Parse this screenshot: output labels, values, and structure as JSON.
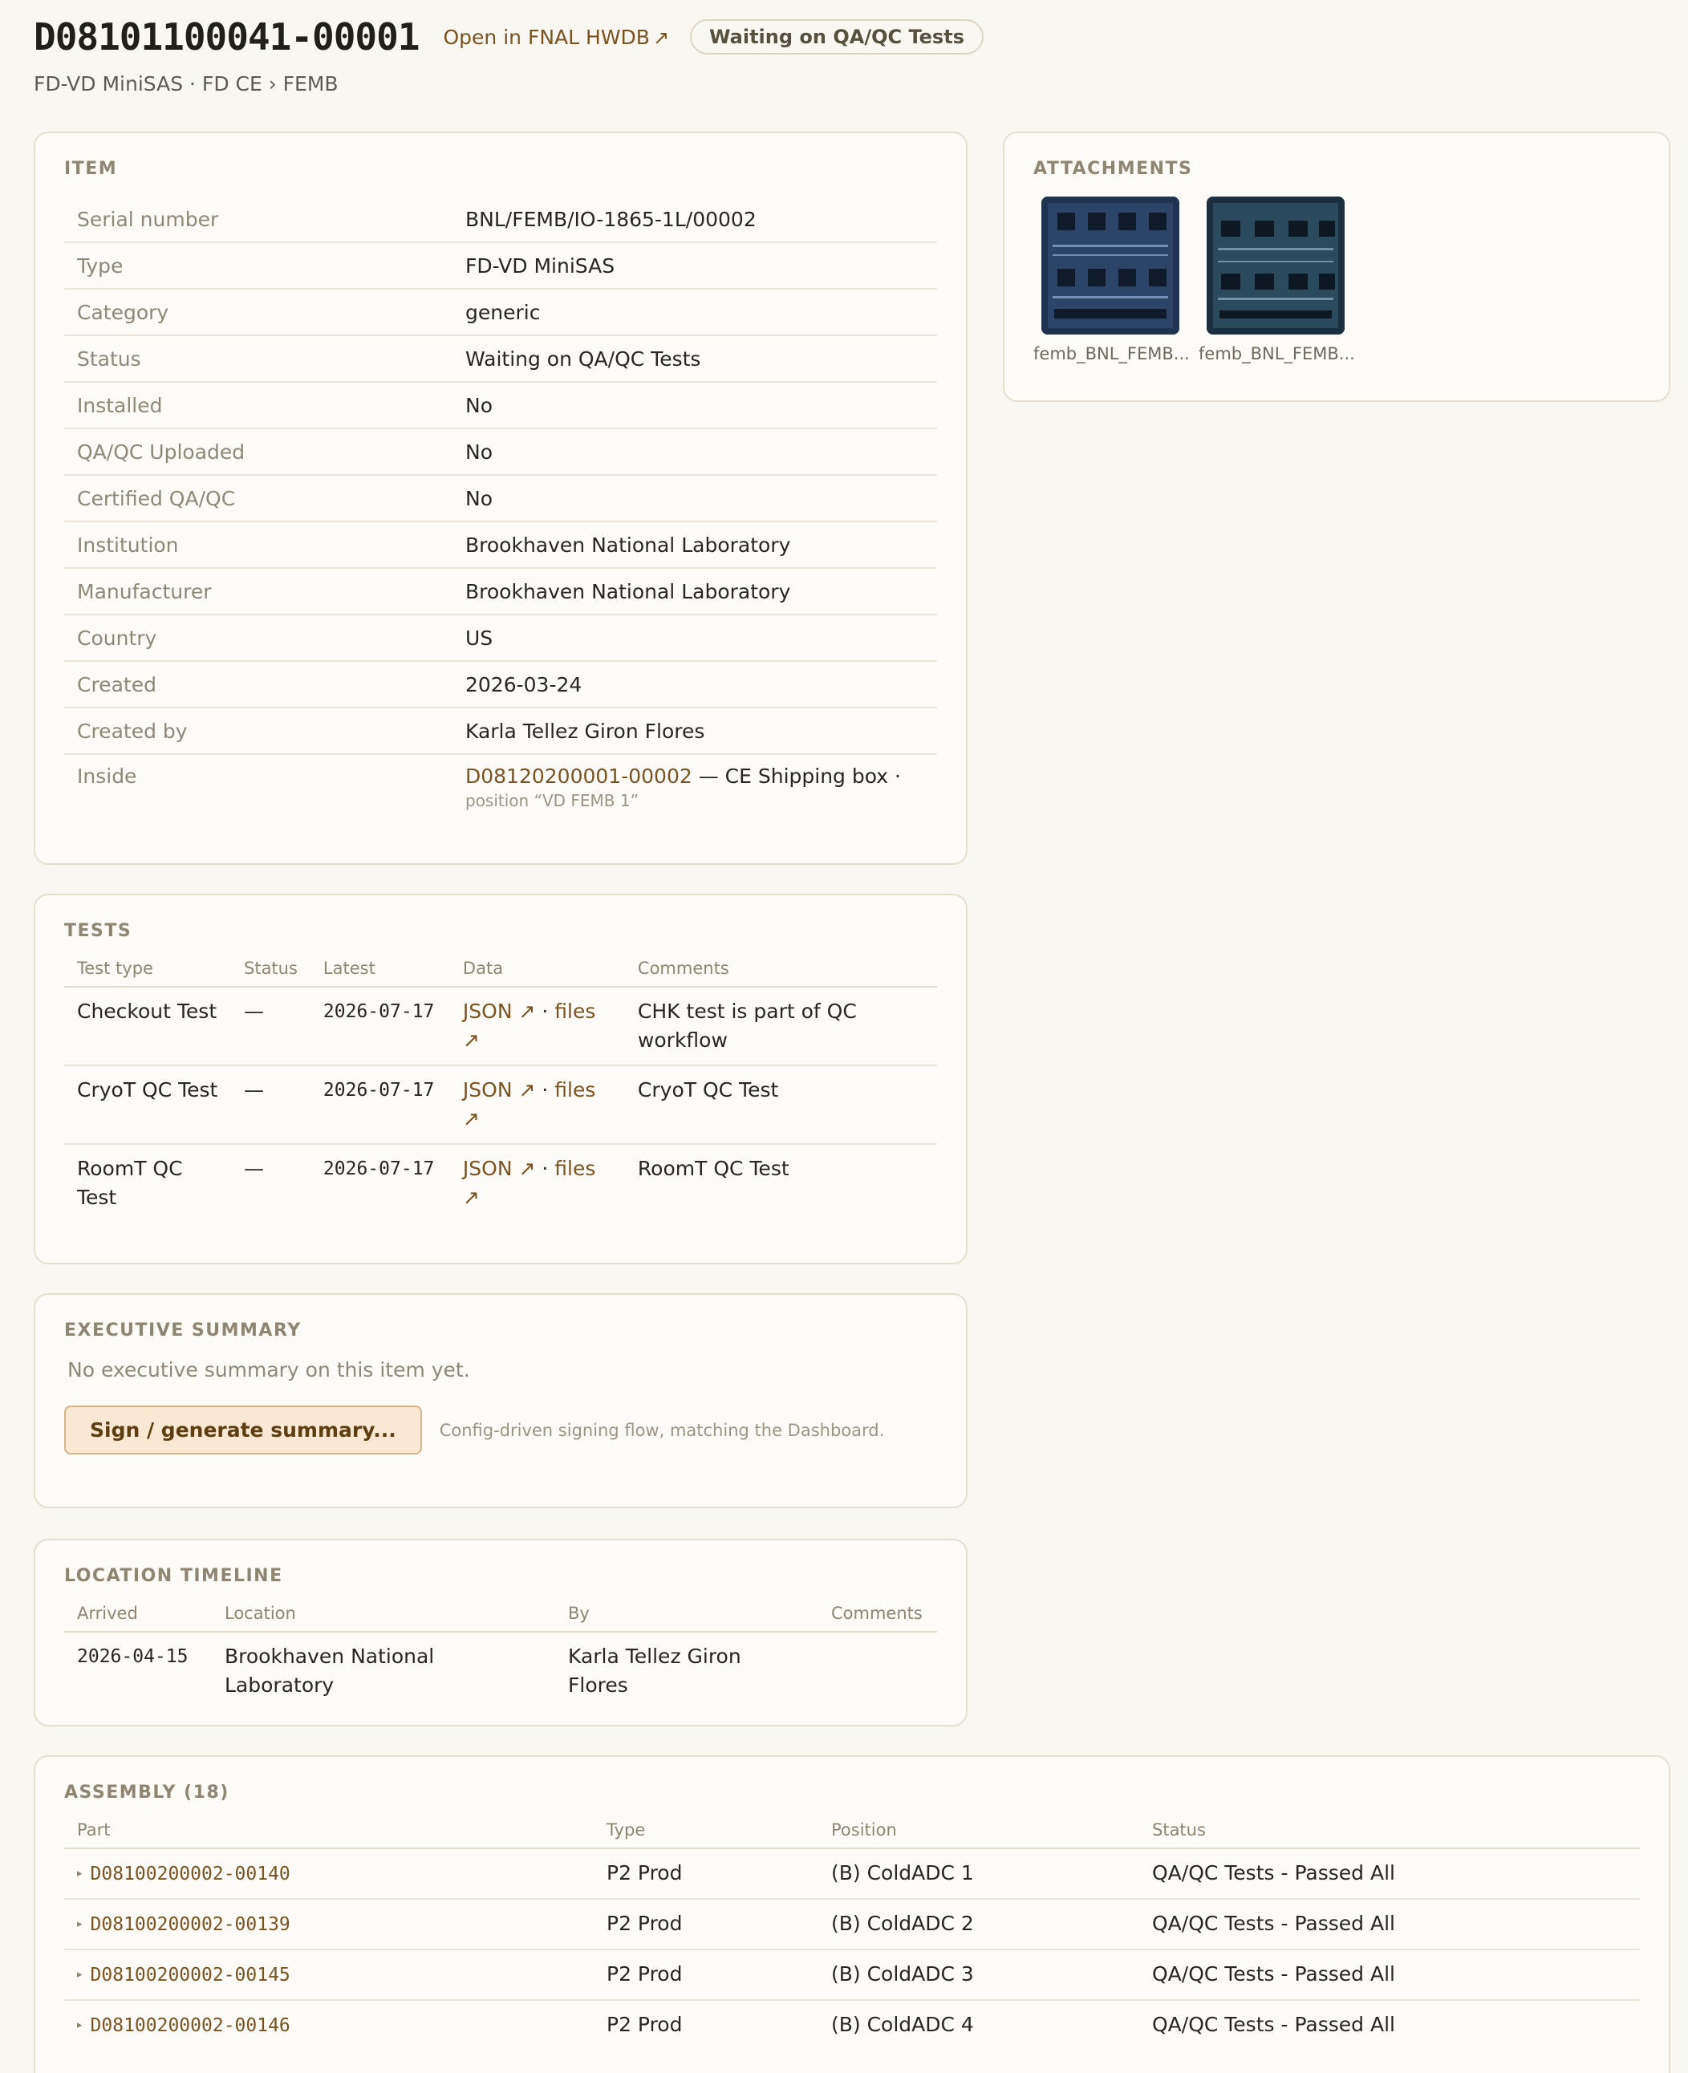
{
  "header": {
    "title": "D08101100041-00001",
    "hwdb_link": "Open in FNAL HWDB",
    "status": "Waiting on QA/QC Tests",
    "subtitle": "FD-VD MiniSAS · FD CE › FEMB"
  },
  "item": {
    "title": "ITEM",
    "rows": [
      {
        "key": "Serial number",
        "value": "BNL/FEMB/IO-1865-1L/00002"
      },
      {
        "key": "Type",
        "value": "FD-VD MiniSAS"
      },
      {
        "key": "Category",
        "value": "generic"
      },
      {
        "key": "Status",
        "value": "Waiting on QA/QC Tests"
      },
      {
        "key": "Installed",
        "value": "No"
      },
      {
        "key": "QA/QC Uploaded",
        "value": "No"
      },
      {
        "key": "Certified QA/QC",
        "value": "No"
      },
      {
        "key": "Institution",
        "value": "Brookhaven National Laboratory"
      },
      {
        "key": "Manufacturer",
        "value": "Brookhaven National Laboratory"
      },
      {
        "key": "Country",
        "value": "US"
      },
      {
        "key": "Created",
        "value": "2026-03-24"
      },
      {
        "key": "Created by",
        "value": "Karla Tellez Giron Flores"
      }
    ],
    "inside": {
      "key": "Inside",
      "link": "D08120200001-00002",
      "text": " — CE Shipping box ·",
      "position": "position “VD FEMB 1”"
    }
  },
  "attachments": {
    "title": "ATTACHMENTS",
    "files": [
      {
        "caption": "femb_BNL_FEMB..."
      },
      {
        "caption": "femb_BNL_FEMB..."
      }
    ]
  },
  "tests": {
    "title": "TESTS",
    "columns": [
      "Test type",
      "Status",
      "Latest",
      "Data",
      "Comments"
    ],
    "data_sep": " · ",
    "rows": [
      {
        "type": "Checkout Test",
        "status": "—",
        "latest": "2026-07-17",
        "json": "JSON",
        "files": "files",
        "comment": "CHK test is part of QC workflow"
      },
      {
        "type": "CryoT QC Test",
        "status": "—",
        "latest": "2026-07-17",
        "json": "JSON",
        "files": "files",
        "comment": "CryoT QC Test"
      },
      {
        "type": "RoomT QC Test",
        "status": "—",
        "latest": "2026-07-17",
        "json": "JSON",
        "files": "files",
        "comment": "RoomT QC Test"
      }
    ]
  },
  "exec": {
    "title": "EXECUTIVE SUMMARY",
    "empty": "No executive summary on this item yet.",
    "button": "Sign / generate summary...",
    "note": "Config-driven signing flow, matching the Dashboard."
  },
  "location": {
    "title": "LOCATION TIMELINE",
    "columns": [
      "Arrived",
      "Location",
      "By",
      "Comments"
    ],
    "rows": [
      {
        "arrived": "2026-04-15",
        "location": "Brookhaven National Laboratory",
        "by": "Karla Tellez Giron Flores",
        "comment": ""
      }
    ]
  },
  "assembly": {
    "title": "ASSEMBLY (18)",
    "columns": [
      "Part",
      "Type",
      "Position",
      "Status"
    ],
    "rows": [
      {
        "part": "D08100200002-00140",
        "type": "P2 Prod",
        "position": "(B) ColdADC 1",
        "status": "QA/QC Tests - Passed All"
      },
      {
        "part": "D08100200002-00139",
        "type": "P2 Prod",
        "position": "(B) ColdADC 2",
        "status": "QA/QC Tests - Passed All"
      },
      {
        "part": "D08100200002-00145",
        "type": "P2 Prod",
        "position": "(B) ColdADC 3",
        "status": "QA/QC Tests - Passed All"
      },
      {
        "part": "D08100200002-00146",
        "type": "P2 Prod",
        "position": "(B) ColdADC 4",
        "status": "QA/QC Tests - Passed All"
      }
    ]
  }
}
